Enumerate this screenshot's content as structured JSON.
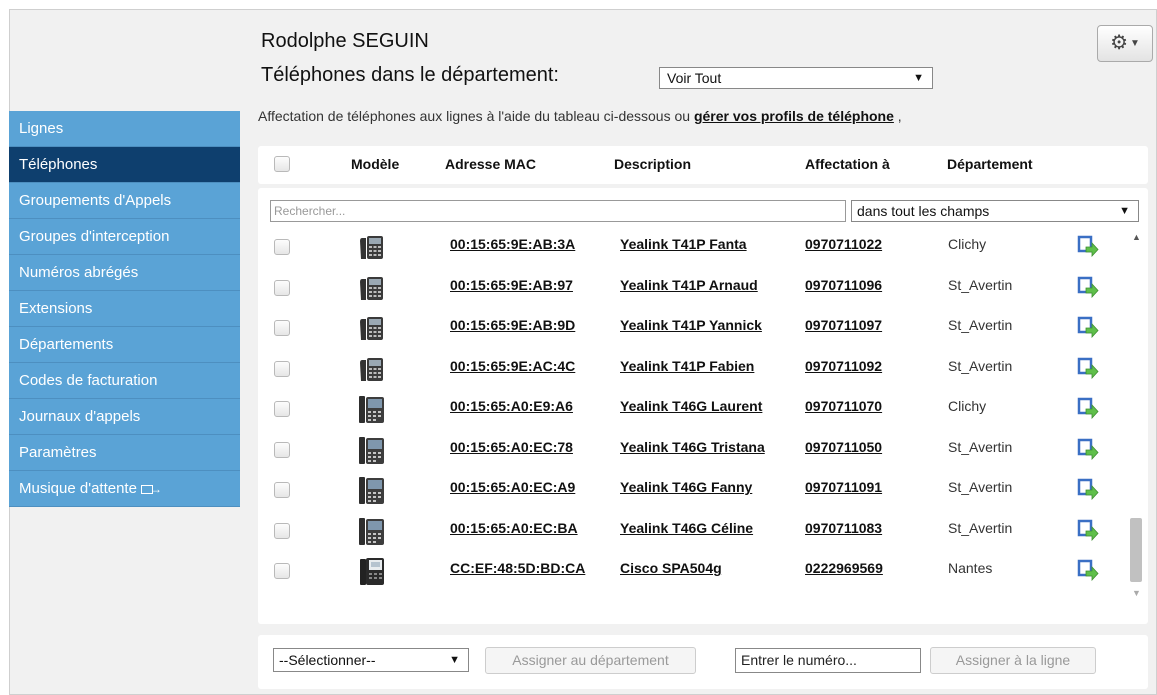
{
  "header": {
    "user_name": "Rodolphe SEGUIN",
    "dept_label": "Téléphones dans le département:",
    "dept_select_value": "Voir Tout",
    "info_text": "Affectation de téléphones aux lignes à l'aide du tableau ci-dessous ou ",
    "info_link": "gérer vos profils de téléphone",
    "info_suffix": " ,"
  },
  "sidebar": {
    "items": [
      {
        "label": "Lignes",
        "active": false
      },
      {
        "label": "Téléphones",
        "active": true
      },
      {
        "label": "Groupements d'Appels",
        "active": false
      },
      {
        "label": "Groupes d'interception",
        "active": false
      },
      {
        "label": "Numéros abrégés",
        "active": false
      },
      {
        "label": "Extensions",
        "active": false
      },
      {
        "label": "Départements",
        "active": false
      },
      {
        "label": "Codes de facturation",
        "active": false
      },
      {
        "label": "Journaux d'appels",
        "active": false
      },
      {
        "label": "Paramètres",
        "active": false
      },
      {
        "label": "Musique d'attente",
        "active": false,
        "external": true
      }
    ]
  },
  "table": {
    "columns": [
      "Modèle",
      "Adresse MAC",
      "Description",
      "Affectation à",
      "Département"
    ],
    "search_placeholder": "Rechercher...",
    "filter_value": "dans tout les champs",
    "rows": [
      {
        "model": "t41p",
        "mac": "00:15:65:9E:AB:3A",
        "description": "Yealink T41P Fanta",
        "number": "0970711022",
        "department": "Clichy"
      },
      {
        "model": "t41p",
        "mac": "00:15:65:9E:AB:97",
        "description": "Yealink T41P Arnaud",
        "number": "0970711096",
        "department": "St_Avertin"
      },
      {
        "model": "t41p",
        "mac": "00:15:65:9E:AB:9D",
        "description": "Yealink T41P Yannick",
        "number": "0970711097",
        "department": "St_Avertin"
      },
      {
        "model": "t41p",
        "mac": "00:15:65:9E:AC:4C",
        "description": "Yealink T41P Fabien",
        "number": "0970711092",
        "department": "St_Avertin"
      },
      {
        "model": "t46g",
        "mac": "00:15:65:A0:E9:A6",
        "description": "Yealink T46G Laurent",
        "number": "0970711070",
        "department": "Clichy"
      },
      {
        "model": "t46g",
        "mac": "00:15:65:A0:EC:78",
        "description": "Yealink T46G Tristana",
        "number": "0970711050",
        "department": "St_Avertin"
      },
      {
        "model": "t46g",
        "mac": "00:15:65:A0:EC:A9",
        "description": "Yealink T46G Fanny",
        "number": "0970711091",
        "department": "St_Avertin"
      },
      {
        "model": "t46g",
        "mac": "00:15:65:A0:EC:BA",
        "description": "Yealink T46G Céline",
        "number": "0970711083",
        "department": "St_Avertin"
      },
      {
        "model": "spa504g",
        "mac": "CC:EF:48:5D:BD:CA",
        "description": "Cisco SPA504g",
        "number": "0222969569",
        "department": "Nantes"
      }
    ]
  },
  "footer": {
    "bulk_select_value": "--Sélectionner--",
    "assign_dept_label": "Assigner au département",
    "number_input_value": "Entrer le numéro...",
    "assign_line_label": "Assigner à la ligne"
  },
  "colors": {
    "sidebar": "#5aa3d6",
    "sidebar_active": "#0e3f6e",
    "page_bg": "#f1f1f1",
    "assign_icon_blue": "#3a6fc4",
    "assign_icon_green": "#5fbf4a"
  },
  "icons": {
    "settings": "gear-icon",
    "assign": "assign-line-icon",
    "external": "external-link-icon"
  }
}
